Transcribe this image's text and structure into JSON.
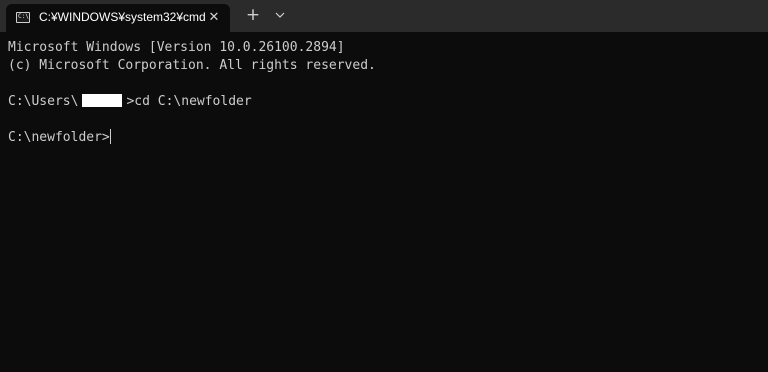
{
  "tab": {
    "title": "C:¥WINDOWS¥system32¥cmd",
    "icon": "cmd-icon",
    "icon_text": "C:\\"
  },
  "tabbar": {
    "close_glyph": "✕",
    "new_tab_glyph": "+",
    "dropdown_icon": "chevron-down-icon"
  },
  "console": {
    "banner_line1": "Microsoft Windows [Version 10.0.26100.2894]",
    "banner_line2": "(c) Microsoft Corporation. All rights reserved.",
    "cmd_prefix": "C:\\Users\\",
    "cmd_suffix": ">cd C:\\newfolder",
    "prompt": "C:\\newfolder>"
  },
  "colors": {
    "background": "#0c0c0c",
    "tabbar": "#2b2b2b",
    "text": "#cccccc"
  }
}
